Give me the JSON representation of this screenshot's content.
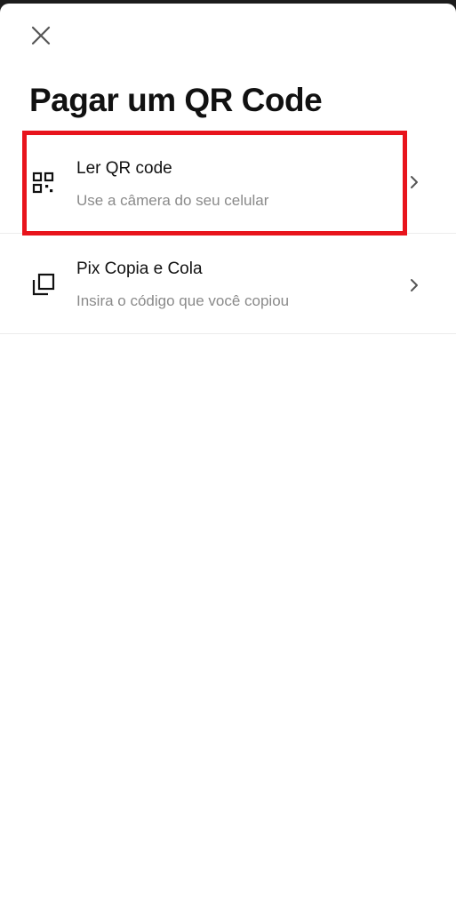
{
  "header": {
    "close_icon": "close-icon",
    "title": "Pagar um QR Code"
  },
  "options": [
    {
      "icon": "qr-code-icon",
      "title": "Ler QR code",
      "subtitle": "Use a câmera do seu celular",
      "trailing_icon": "chevron-right-icon"
    },
    {
      "icon": "copy-icon",
      "title": "Pix Copia e Cola",
      "subtitle": "Insira o código que você copiou",
      "trailing_icon": "chevron-right-icon"
    }
  ],
  "colors": {
    "background": "#ffffff",
    "text_primary": "#111111",
    "text_secondary": "#8a8a8a",
    "divider": "#ececec",
    "highlight": "#e8141c"
  }
}
